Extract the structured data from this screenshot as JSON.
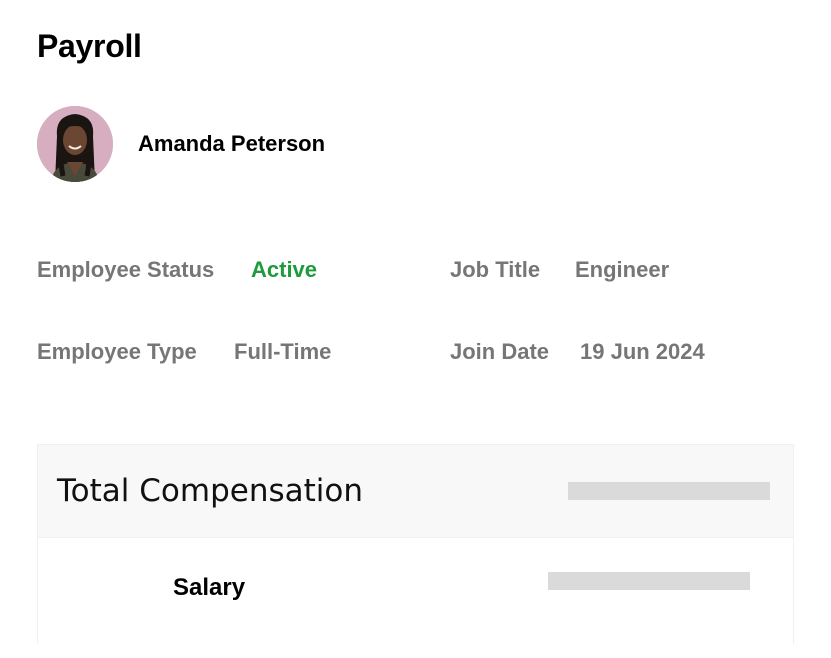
{
  "page": {
    "title": "Payroll"
  },
  "employee": {
    "name": "Amanda Peterson",
    "avatar_icon": "person-photo-avatar"
  },
  "info": {
    "status_label": "Employee Status",
    "status_value": "Active",
    "status_color": "#1f9a3d",
    "type_label": "Employee Type",
    "type_value": "Full-Time",
    "job_title_label": "Job Title",
    "job_title_value": "Engineer",
    "join_date_label": "Join Date",
    "join_date_value": "19 Jun 2024"
  },
  "compensation": {
    "title": "Total Compensation",
    "salary_label": "Salary"
  }
}
